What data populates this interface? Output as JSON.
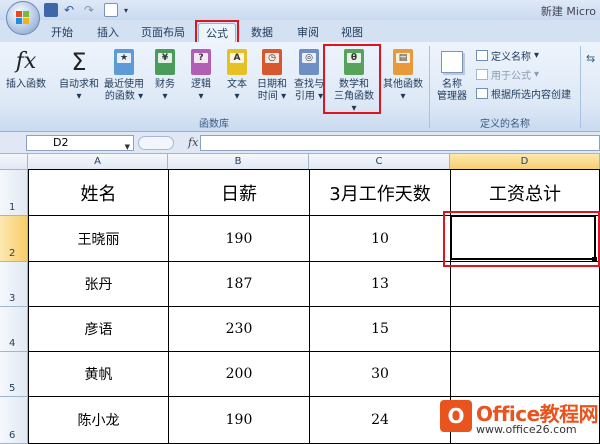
{
  "window": {
    "title": "新建 Micro"
  },
  "tabs": [
    {
      "label": "开始"
    },
    {
      "label": "插入"
    },
    {
      "label": "页面布局"
    },
    {
      "label": "公式"
    },
    {
      "label": "数据"
    },
    {
      "label": "审阅"
    },
    {
      "label": "视图"
    }
  ],
  "active_tab": "公式",
  "ribbon": {
    "function_library": {
      "label": "函数库",
      "insert_function": "插入函数",
      "autosum": "自动求和",
      "recent_line1": "最近使用",
      "recent_line2": "的函数",
      "financial": "财务",
      "logical": "逻辑",
      "text": "文本",
      "datetime_line1": "日期和",
      "datetime_line2": "时间",
      "lookup_line1": "查找与",
      "lookup_line2": "引用",
      "math_line1": "数学和",
      "math_line2": "三角函数",
      "more": "其他函数"
    },
    "defined_names": {
      "label": "定义的名称",
      "name_manager_line1": "名称",
      "name_manager_line2": "管理器",
      "define_name": "定义名称",
      "use_in_formula": "用于公式",
      "create_from_selection": "根据所选内容创建"
    },
    "book_glyphs": {
      "logical": "?",
      "text": "A",
      "math": "θ"
    }
  },
  "formula_bar": {
    "cell_ref": "D2",
    "fx": "fx",
    "value": ""
  },
  "sheet": {
    "columns": [
      "A",
      "B",
      "C",
      "D"
    ],
    "rows": [
      "1",
      "2",
      "3",
      "4",
      "5",
      "6"
    ],
    "header": [
      "姓名",
      "日薪",
      "3月工作天数",
      "工资总计"
    ],
    "data": [
      [
        "王晓丽",
        "190",
        "10",
        ""
      ],
      [
        "张丹",
        "187",
        "13",
        ""
      ],
      [
        "彦语",
        "230",
        "15",
        ""
      ],
      [
        "黄帆",
        "200",
        "30",
        ""
      ],
      [
        "陈小龙",
        "190",
        "24",
        ""
      ]
    ],
    "selected_cell": "D2"
  },
  "watermark": {
    "brand": "Office教程网",
    "url": "www.office26.com"
  },
  "colors": {
    "highlight": "#e0141e",
    "watermark": "#e8531e"
  }
}
